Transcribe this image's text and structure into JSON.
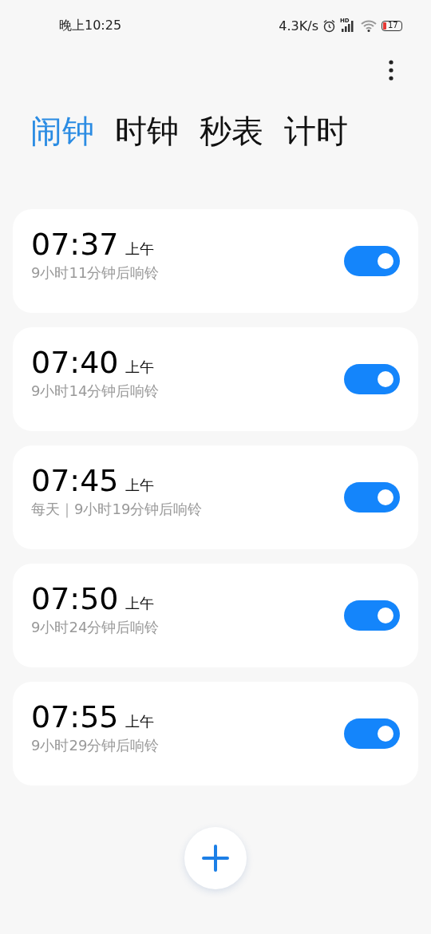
{
  "status_bar": {
    "time": "晚上10:25",
    "speed": "4.3K/s",
    "signal_label": "HD",
    "battery": "17"
  },
  "tabs": [
    {
      "label": "闹钟",
      "selected": true
    },
    {
      "label": "时钟",
      "selected": false
    },
    {
      "label": "秒表",
      "selected": false
    },
    {
      "label": "计时",
      "selected": false
    }
  ],
  "alarms": [
    {
      "time": "07:37",
      "period": "上午",
      "note": "9小时11分钟后响铃",
      "on": true
    },
    {
      "time": "07:40",
      "period": "上午",
      "note": "9小时14分钟后响铃",
      "on": true
    },
    {
      "time": "07:45",
      "period": "上午",
      "note": "每天｜9小时19分钟后响铃",
      "on": true
    },
    {
      "time": "07:50",
      "period": "上午",
      "note": "9小时24分钟后响铃",
      "on": true
    },
    {
      "time": "07:55",
      "period": "上午",
      "note": "9小时29分钟后响铃",
      "on": true
    }
  ]
}
